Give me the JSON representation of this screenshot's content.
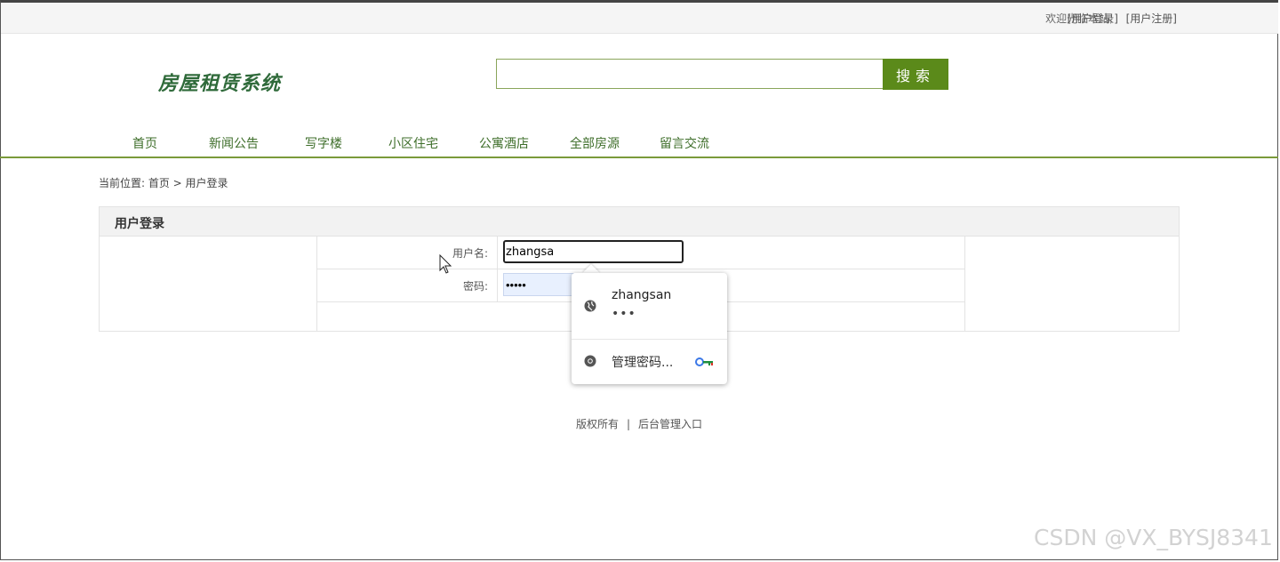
{
  "topbar": {
    "welcome": "欢迎光临本站,",
    "login_link": "[用户登录]",
    "register_link": "[用户注册]"
  },
  "header": {
    "logo": "房屋租赁系统",
    "search_value": "",
    "search_button": "搜索"
  },
  "nav": {
    "items": [
      "首页",
      "新闻公告",
      "写字楼",
      "小区住宅",
      "公寓酒店",
      "全部房源",
      "留言交流"
    ]
  },
  "breadcrumb": "当前位置: 首页 > 用户登录",
  "login": {
    "title": "用户登录",
    "username_label": "用户名:",
    "username_value": "zhangsa",
    "password_label": "密码:",
    "password_value": "•••••"
  },
  "autocomplete": {
    "suggested_user": "zhangsan",
    "suggested_password_mask": "•••",
    "manage_label": "管理密码..."
  },
  "footer": {
    "copyright": "版权所有",
    "separator": "|",
    "admin_link": "后台管理入口"
  },
  "watermark": "CSDN @VX_BYSJ8341",
  "colors": {
    "accent_green": "#5b8a1a",
    "nav_text": "#3e6e2a",
    "logo": "#2f6a3a"
  }
}
